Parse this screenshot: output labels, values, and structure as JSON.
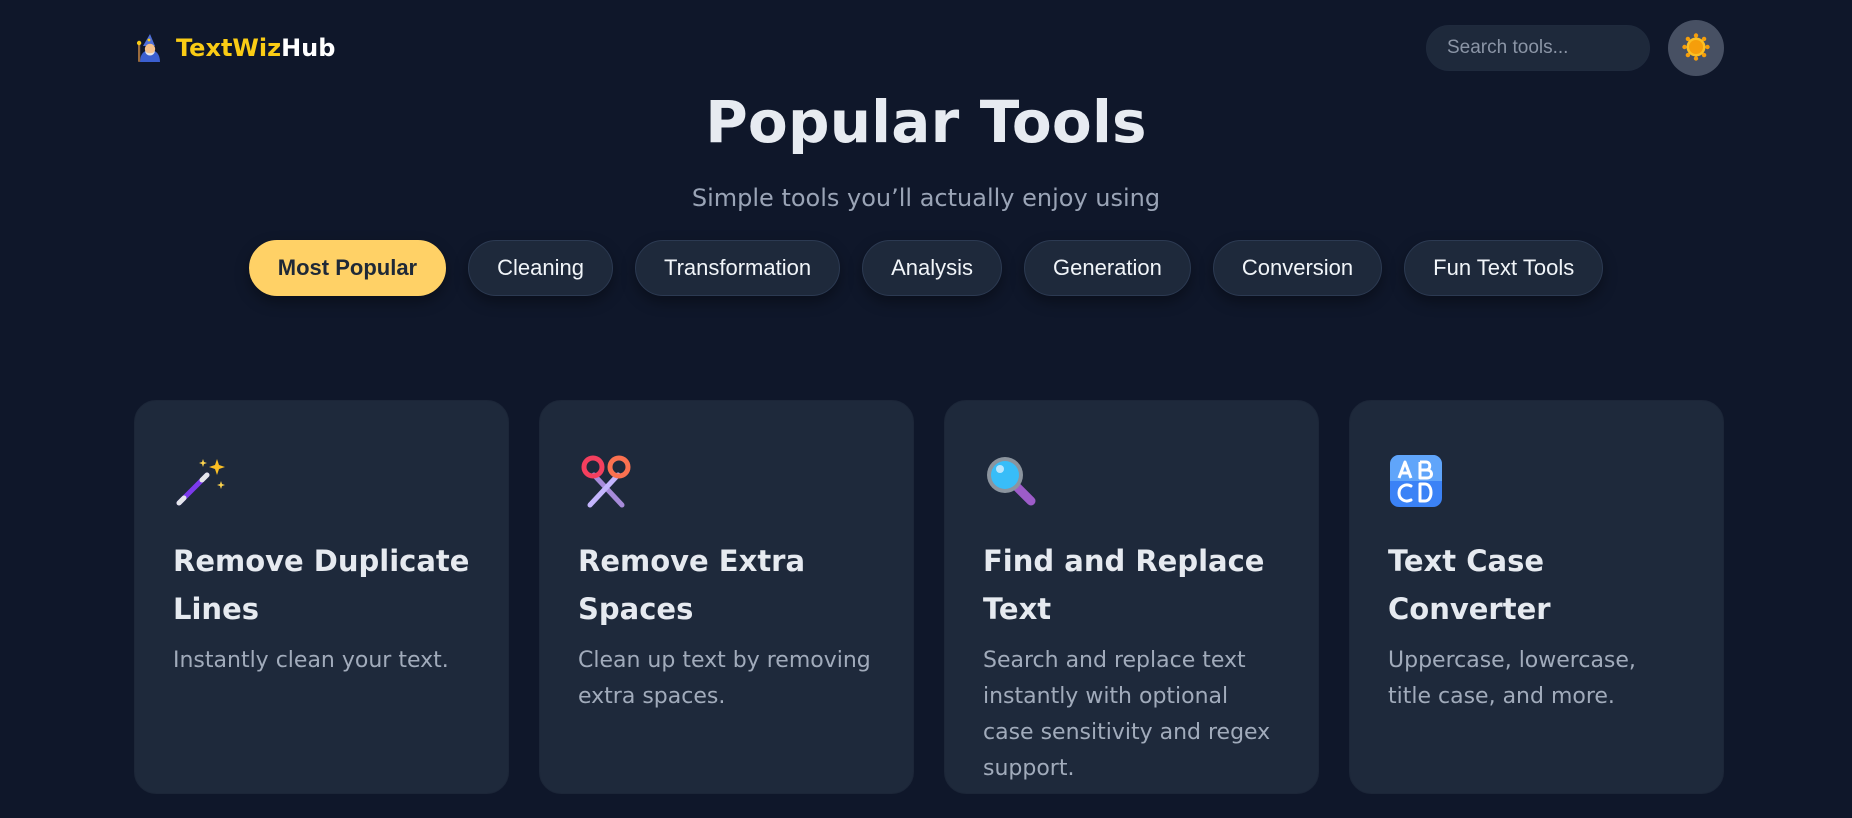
{
  "header": {
    "logo_part1": "TextWiz",
    "logo_part2": "Hub",
    "logo_icon": "wizard-icon",
    "search_placeholder": "Search tools...",
    "theme_icon": "sun-icon"
  },
  "main": {
    "title": "Popular Tools",
    "subtitle": "Simple tools you’ll actually enjoy using"
  },
  "filters": [
    {
      "label": "Most Popular",
      "active": true
    },
    {
      "label": "Cleaning",
      "active": false
    },
    {
      "label": "Transformation",
      "active": false
    },
    {
      "label": "Analysis",
      "active": false
    },
    {
      "label": "Generation",
      "active": false
    },
    {
      "label": "Conversion",
      "active": false
    },
    {
      "label": "Fun Text Tools",
      "active": false
    }
  ],
  "cards": [
    {
      "icon": "magic-wand-icon",
      "title": "Remove Duplicate Lines",
      "description": "Instantly clean your text."
    },
    {
      "icon": "scissors-icon",
      "title": "Remove Extra Spaces",
      "description": "Clean up text by removing extra spaces."
    },
    {
      "icon": "magnifying-glass-icon",
      "title": "Find and Replace Text",
      "description": "Search and replace text instantly with optional case sensitivity and regex support."
    },
    {
      "icon": "abcd-icon",
      "title": "Text Case Converter",
      "description": "Uppercase, lowercase, title case, and more."
    }
  ],
  "colors": {
    "background": "#0f172a",
    "card": "#1e293b",
    "accent": "#ffd166",
    "logo_accent": "#facc15"
  }
}
